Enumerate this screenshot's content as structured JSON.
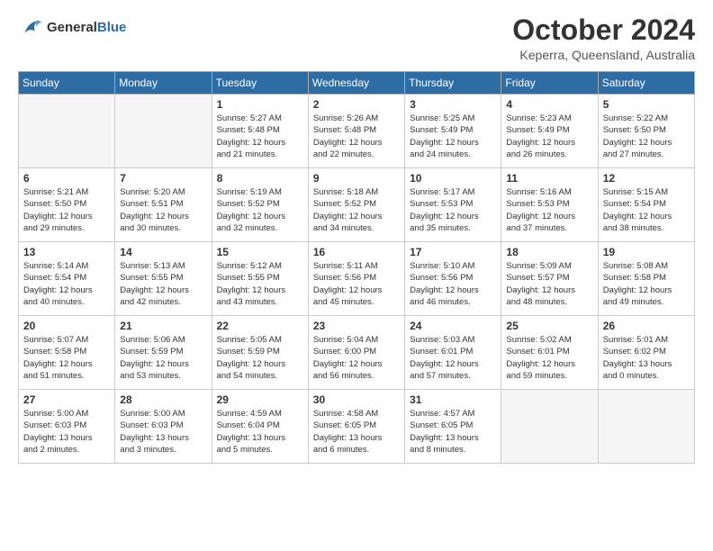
{
  "logo": {
    "line1": "General",
    "line2": "Blue"
  },
  "title": "October 2024",
  "subtitle": "Keperra, Queensland, Australia",
  "weekdays": [
    "Sunday",
    "Monday",
    "Tuesday",
    "Wednesday",
    "Thursday",
    "Friday",
    "Saturday"
  ],
  "weeks": [
    [
      {
        "day": "",
        "info": ""
      },
      {
        "day": "",
        "info": ""
      },
      {
        "day": "1",
        "info": "Sunrise: 5:27 AM\nSunset: 5:48 PM\nDaylight: 12 hours\nand 21 minutes."
      },
      {
        "day": "2",
        "info": "Sunrise: 5:26 AM\nSunset: 5:48 PM\nDaylight: 12 hours\nand 22 minutes."
      },
      {
        "day": "3",
        "info": "Sunrise: 5:25 AM\nSunset: 5:49 PM\nDaylight: 12 hours\nand 24 minutes."
      },
      {
        "day": "4",
        "info": "Sunrise: 5:23 AM\nSunset: 5:49 PM\nDaylight: 12 hours\nand 26 minutes."
      },
      {
        "day": "5",
        "info": "Sunrise: 5:22 AM\nSunset: 5:50 PM\nDaylight: 12 hours\nand 27 minutes."
      }
    ],
    [
      {
        "day": "6",
        "info": "Sunrise: 5:21 AM\nSunset: 5:50 PM\nDaylight: 12 hours\nand 29 minutes."
      },
      {
        "day": "7",
        "info": "Sunrise: 5:20 AM\nSunset: 5:51 PM\nDaylight: 12 hours\nand 30 minutes."
      },
      {
        "day": "8",
        "info": "Sunrise: 5:19 AM\nSunset: 5:52 PM\nDaylight: 12 hours\nand 32 minutes."
      },
      {
        "day": "9",
        "info": "Sunrise: 5:18 AM\nSunset: 5:52 PM\nDaylight: 12 hours\nand 34 minutes."
      },
      {
        "day": "10",
        "info": "Sunrise: 5:17 AM\nSunset: 5:53 PM\nDaylight: 12 hours\nand 35 minutes."
      },
      {
        "day": "11",
        "info": "Sunrise: 5:16 AM\nSunset: 5:53 PM\nDaylight: 12 hours\nand 37 minutes."
      },
      {
        "day": "12",
        "info": "Sunrise: 5:15 AM\nSunset: 5:54 PM\nDaylight: 12 hours\nand 38 minutes."
      }
    ],
    [
      {
        "day": "13",
        "info": "Sunrise: 5:14 AM\nSunset: 5:54 PM\nDaylight: 12 hours\nand 40 minutes."
      },
      {
        "day": "14",
        "info": "Sunrise: 5:13 AM\nSunset: 5:55 PM\nDaylight: 12 hours\nand 42 minutes."
      },
      {
        "day": "15",
        "info": "Sunrise: 5:12 AM\nSunset: 5:55 PM\nDaylight: 12 hours\nand 43 minutes."
      },
      {
        "day": "16",
        "info": "Sunrise: 5:11 AM\nSunset: 5:56 PM\nDaylight: 12 hours\nand 45 minutes."
      },
      {
        "day": "17",
        "info": "Sunrise: 5:10 AM\nSunset: 5:56 PM\nDaylight: 12 hours\nand 46 minutes."
      },
      {
        "day": "18",
        "info": "Sunrise: 5:09 AM\nSunset: 5:57 PM\nDaylight: 12 hours\nand 48 minutes."
      },
      {
        "day": "19",
        "info": "Sunrise: 5:08 AM\nSunset: 5:58 PM\nDaylight: 12 hours\nand 49 minutes."
      }
    ],
    [
      {
        "day": "20",
        "info": "Sunrise: 5:07 AM\nSunset: 5:58 PM\nDaylight: 12 hours\nand 51 minutes."
      },
      {
        "day": "21",
        "info": "Sunrise: 5:06 AM\nSunset: 5:59 PM\nDaylight: 12 hours\nand 53 minutes."
      },
      {
        "day": "22",
        "info": "Sunrise: 5:05 AM\nSunset: 5:59 PM\nDaylight: 12 hours\nand 54 minutes."
      },
      {
        "day": "23",
        "info": "Sunrise: 5:04 AM\nSunset: 6:00 PM\nDaylight: 12 hours\nand 56 minutes."
      },
      {
        "day": "24",
        "info": "Sunrise: 5:03 AM\nSunset: 6:01 PM\nDaylight: 12 hours\nand 57 minutes."
      },
      {
        "day": "25",
        "info": "Sunrise: 5:02 AM\nSunset: 6:01 PM\nDaylight: 12 hours\nand 59 minutes."
      },
      {
        "day": "26",
        "info": "Sunrise: 5:01 AM\nSunset: 6:02 PM\nDaylight: 13 hours\nand 0 minutes."
      }
    ],
    [
      {
        "day": "27",
        "info": "Sunrise: 5:00 AM\nSunset: 6:03 PM\nDaylight: 13 hours\nand 2 minutes."
      },
      {
        "day": "28",
        "info": "Sunrise: 5:00 AM\nSunset: 6:03 PM\nDaylight: 13 hours\nand 3 minutes."
      },
      {
        "day": "29",
        "info": "Sunrise: 4:59 AM\nSunset: 6:04 PM\nDaylight: 13 hours\nand 5 minutes."
      },
      {
        "day": "30",
        "info": "Sunrise: 4:58 AM\nSunset: 6:05 PM\nDaylight: 13 hours\nand 6 minutes."
      },
      {
        "day": "31",
        "info": "Sunrise: 4:57 AM\nSunset: 6:05 PM\nDaylight: 13 hours\nand 8 minutes."
      },
      {
        "day": "",
        "info": ""
      },
      {
        "day": "",
        "info": ""
      }
    ]
  ]
}
